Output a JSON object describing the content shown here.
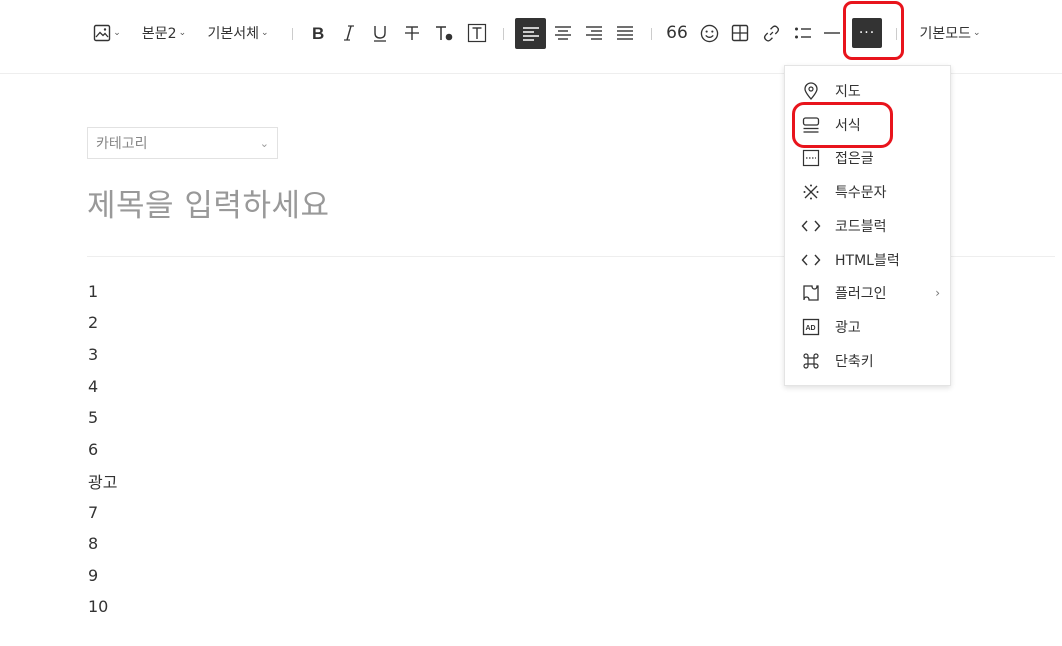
{
  "toolbar": {
    "paragraph_style": "본문2",
    "font_family": "기본서체",
    "quote_label": "66",
    "mode": "기본모드",
    "more_label": "···"
  },
  "editor": {
    "category_placeholder": "카테고리",
    "title_placeholder": "제목을 입력하세요",
    "lines": [
      "1",
      "2",
      "3",
      "4",
      "5",
      "6",
      "광고",
      "7",
      "8",
      "9",
      "10"
    ]
  },
  "more_menu": {
    "items": [
      {
        "label": "지도",
        "icon": "map-pin-icon"
      },
      {
        "label": "서식",
        "icon": "template-icon"
      },
      {
        "label": "접은글",
        "icon": "fold-icon"
      },
      {
        "label": "특수문자",
        "icon": "special-char-icon"
      },
      {
        "label": "코드블럭",
        "icon": "code-icon"
      },
      {
        "label": "HTML블럭",
        "icon": "html-icon"
      },
      {
        "label": "플러그인",
        "icon": "plugin-icon"
      },
      {
        "label": "광고",
        "icon": "ad-icon"
      },
      {
        "label": "단축키",
        "icon": "command-icon"
      }
    ]
  },
  "colors": {
    "highlight": "#e8141c",
    "active_button": "#333333"
  }
}
